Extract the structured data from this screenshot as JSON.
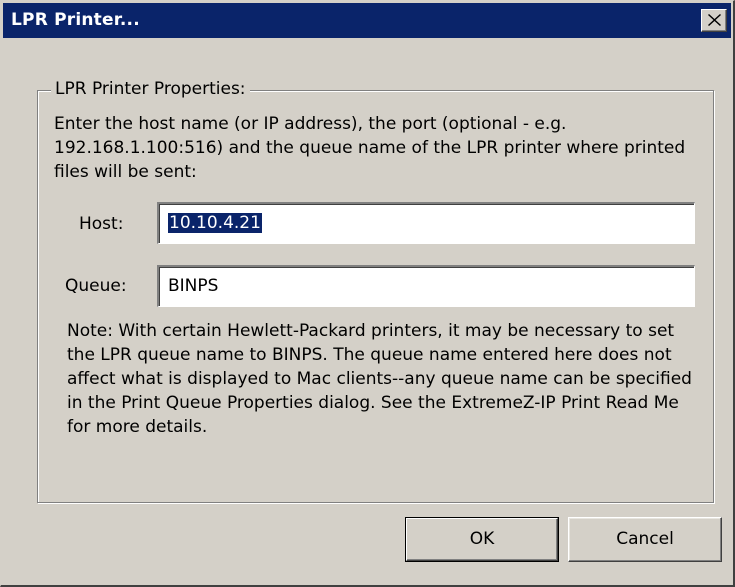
{
  "window": {
    "title": "LPR Printer..."
  },
  "icons": {
    "close": "close-icon"
  },
  "group": {
    "legend": "LPR Printer Properties:",
    "instructions": "Enter the host name (or IP address), the port (optional - e.g. 192.168.1.100:516) and the queue name of the LPR printer where printed files will be sent:"
  },
  "fields": {
    "host_label": "Host:",
    "host_value": "10.10.4.21",
    "queue_label": "Queue:",
    "queue_value": "BINPS"
  },
  "note": "Note: With certain Hewlett-Packard printers, it may be necessary to set the LPR queue name to BINPS.  The queue name entered here does not affect what is displayed to Mac clients--any queue name can be specified in the Print Queue Properties dialog.  See the ExtremeZ-IP Print Read Me for more details.",
  "buttons": {
    "ok": "OK",
    "cancel": "Cancel"
  },
  "colors": {
    "titlebar": "#0a246a",
    "dialog_face": "#d4d0c8",
    "selection": "#0a246a"
  }
}
